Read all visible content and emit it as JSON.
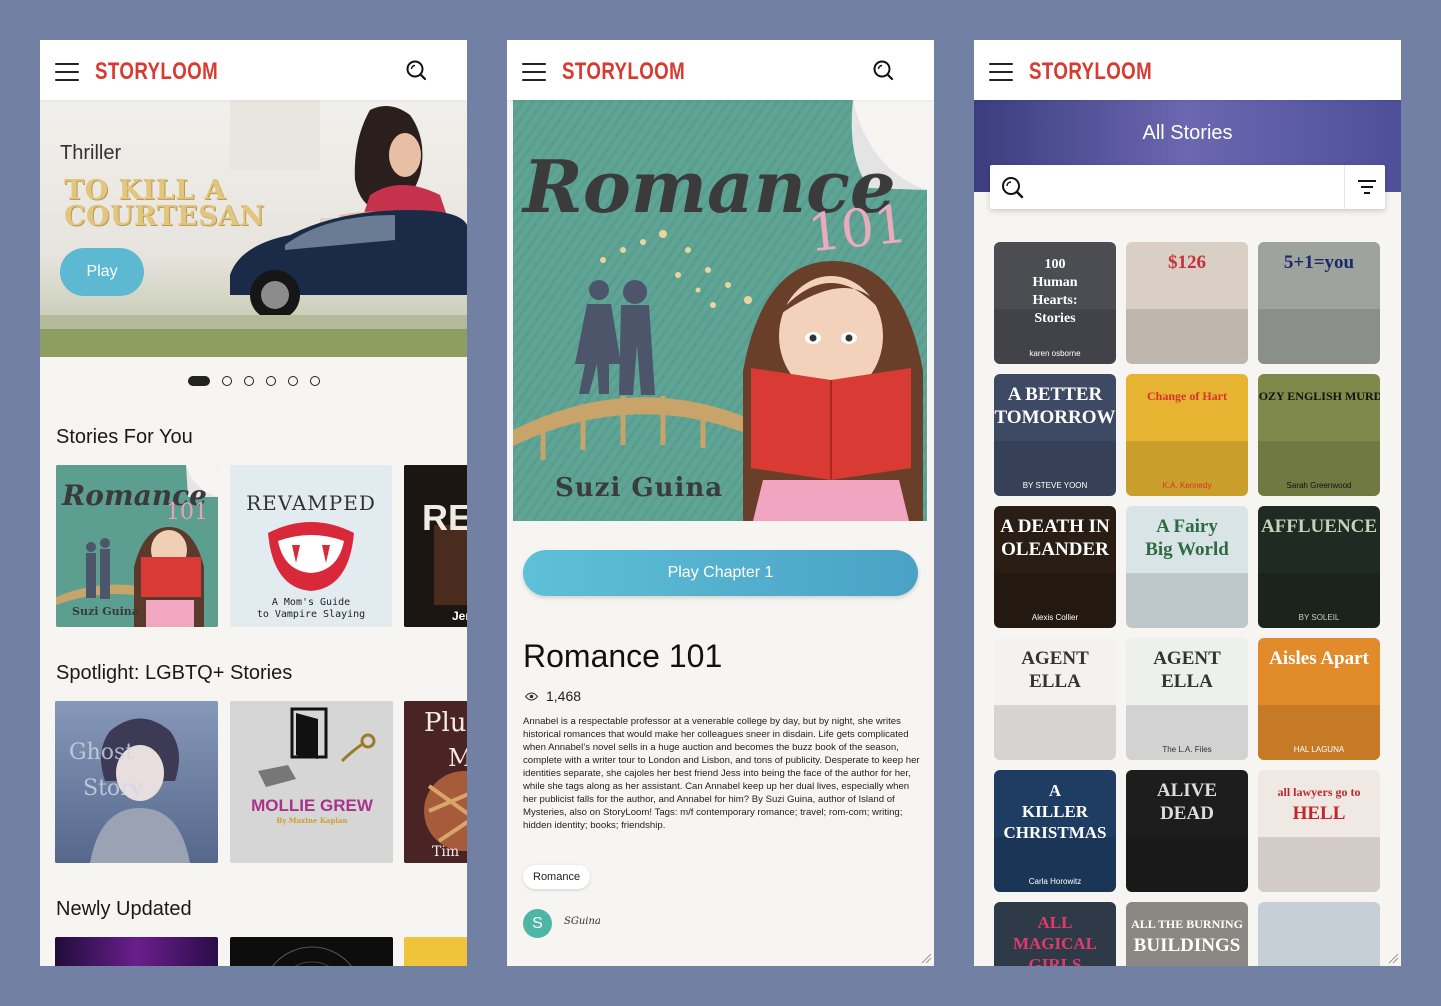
{
  "brand": {
    "name": "STORYLOOM",
    "color": "#d83a30"
  },
  "panel1": {
    "hero": {
      "genre": "Thriller",
      "title": "TO KILL A\nCOURTESAN",
      "play_label": "Play"
    },
    "carousel": {
      "count": 6,
      "active_index": 0
    },
    "sections": [
      {
        "title": "Stories For You",
        "cards": [
          {
            "title": "Romance",
            "subtitle": "101",
            "author": "Suzi Guina"
          },
          {
            "title": "REVAMPED",
            "subtitle": "A Mom's Guide",
            "subtitle2": "to Vampire Slaying"
          },
          {
            "title": "REC",
            "author": "Jen"
          }
        ]
      },
      {
        "title": "Spotlight: LGBTQ+ Stories",
        "cards": [
          {
            "title": "Ghost",
            "title2": "Story"
          },
          {
            "title": "MOLLIE GREW",
            "author": "By Maxine Kaplan"
          },
          {
            "title": "Plu",
            "title2": "M",
            "footer": "Tim"
          }
        ]
      },
      {
        "title": "Newly Updated",
        "cards": [
          {},
          {},
          {}
        ]
      }
    ]
  },
  "panel2": {
    "cover": {
      "title": "Romance",
      "number": "101",
      "author": "Suzi Guina"
    },
    "play_label": "Play Chapter 1",
    "title": "Romance 101",
    "views": "1,468",
    "description": "Annabel is a respectable professor at a venerable college by day, but by night, she writes historical romances that would make her colleagues sneer in disdain. Life gets complicated when Annabel’s novel sells in a huge auction and becomes the buzz book of the season, complete with a writer tour to London and Lisbon, and tons of publicity. Desperate to keep her identities separate, she cajoles her best friend Jess into being the face of the author for her, while she tags along as her assistant. Can Annabel keep up her dual lives, especially when her publicist falls for the author, and Annabel for him? By Suzi Guina, author of Island of Mysteries, also on StoryLoom! Tags: m/f contemporary romance; travel; rom-com; writing; hidden identity; books; friendship.",
    "tag": "Romance",
    "author_initial": "S",
    "author_name": "SGuina"
  },
  "panel3": {
    "title": "All Stories",
    "search_placeholder": "",
    "tiles": [
      {
        "lines": [
          "100",
          "Human",
          "Hearts:",
          "Stories"
        ],
        "author": "karen osborne",
        "bg": "#4b4d52",
        "fg": "#ffffff"
      },
      {
        "lines": [
          "$126"
        ],
        "author": "",
        "bg": "#d9cfc4",
        "fg": "#c7303a"
      },
      {
        "lines": [
          "5+1=you"
        ],
        "author": "",
        "bg": "#9ea39e",
        "fg": "#1c2a6b"
      },
      {
        "lines": [
          "A BETTER",
          "TOMORROW"
        ],
        "author": "BY STEVE YOON",
        "bg": "#3e4a63",
        "fg": "#ffffff"
      },
      {
        "lines": [
          "Change of Hart"
        ],
        "author": "K.A. Kennedy",
        "bg": "#e6b430",
        "fg": "#d8322c"
      },
      {
        "lines": [
          "A COZY ENGLISH MURDER"
        ],
        "author": "Sarah Greenwood",
        "bg": "#7f8a4a",
        "fg": "#111111"
      },
      {
        "lines": [
          "A DEATH IN",
          "OLEANDER"
        ],
        "author": "Alexis Collier",
        "bg": "#2a1d14",
        "fg": "#ffffff"
      },
      {
        "lines": [
          "A Fairy",
          "Big World"
        ],
        "author": "",
        "bg": "#d9e4e6",
        "fg": "#2f6b42"
      },
      {
        "lines": [
          "AFFLUENCE"
        ],
        "author": "BY SOLEIL",
        "bg": "#1e2a22",
        "fg": "#c9cfb8"
      },
      {
        "lines": [
          "AGENT",
          "ELLA"
        ],
        "author": "",
        "bg": "#f3f2ef",
        "fg": "#333333"
      },
      {
        "lines": [
          "AGENT",
          "ELLA"
        ],
        "author": "The L.A. Files",
        "bg": "#eef0ee",
        "fg": "#333333"
      },
      {
        "lines": [
          "Aisles Apart"
        ],
        "author": "HAL LAGUNA",
        "bg": "#e28b2b",
        "fg": "#ffffff"
      },
      {
        "lines": [
          "A",
          "KILLER",
          "CHRISTMAS"
        ],
        "author": "Carla Horowitz",
        "bg": "#1f3d63",
        "fg": "#ffffff"
      },
      {
        "lines": [
          "ALIVE",
          "DEAD"
        ],
        "author": "",
        "bg": "#1d1d1d",
        "fg": "#dddddd"
      },
      {
        "lines": [
          "all lawyers go to",
          "HELL"
        ],
        "author": "",
        "bg": "#f0e8e2",
        "fg": "#c0262c"
      },
      {
        "lines": [
          "ALL",
          "MAGICAL",
          "GIRLS"
        ],
        "author": "",
        "bg": "#2e3a48",
        "fg": "#e23a6b"
      },
      {
        "lines": [
          "ALL THE BURNING",
          "BUILDINGS"
        ],
        "author": "",
        "bg": "#8b8884",
        "fg": "#ffffff"
      },
      {
        "lines": [],
        "author": "",
        "bg": "#c7cfd6",
        "fg": "#ffffff"
      }
    ]
  }
}
